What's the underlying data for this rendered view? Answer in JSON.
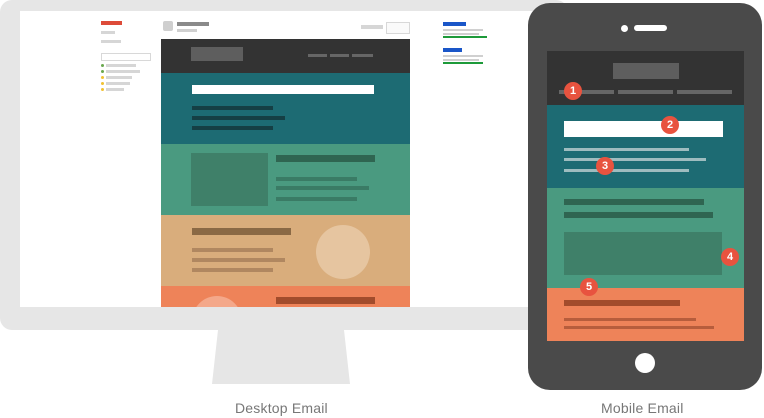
{
  "colors": {
    "monitor_frame": "#e6e6e6",
    "phone_body": "#4a4a4a",
    "email_header": "#333333",
    "teal_section": "#1d6b73",
    "green_section": "#4a9a80",
    "tan_section": "#d9ad7c",
    "orange_section": "#ee8359",
    "badge": "#e8533f",
    "bar_white": "#ffffff"
  },
  "captions": {
    "desktop": "Desktop Email",
    "mobile": "Mobile Email"
  },
  "badges": [
    "1",
    "2",
    "3",
    "4",
    "5"
  ],
  "icons": {
    "gmail_logo": "gmail-logo-icon",
    "avatar": "avatar-icon",
    "phone_camera": "camera-icon",
    "phone_speaker": "speaker-icon",
    "home_button": "home-button-icon"
  }
}
